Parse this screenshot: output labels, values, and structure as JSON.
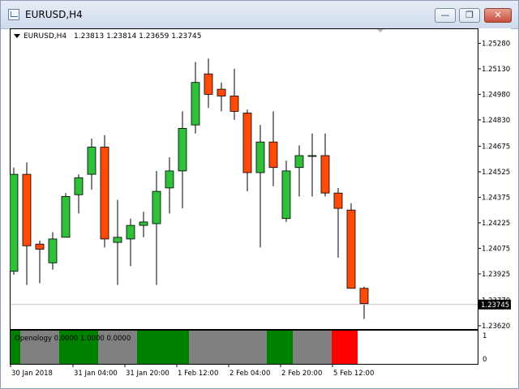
{
  "window": {
    "title": "EURUSD,H4",
    "app_icon": "chart-window-icon",
    "buttons": [
      "minimize-icon",
      "restore-icon",
      "close-icon"
    ],
    "button_glyphs": {
      "minimize": "—",
      "restore": "❐",
      "close": "✕"
    }
  },
  "chart_header": {
    "symbol": "EURUSD,H4",
    "ohlc": "1.23813 1.23814 1.23659 1.23745"
  },
  "indicator": {
    "label": "Openology 0.0000 1.0000 0.0000",
    "axis_labels": [
      "1",
      "0"
    ]
  },
  "colors": {
    "bull": "#2fbf3a",
    "bear": "#ff4b0a",
    "ind_green": "#008000",
    "ind_gray": "#808080",
    "ind_red": "#ff0000"
  },
  "chart_data": {
    "type": "candlestick",
    "ylim": [
      1.2362,
      1.2532
    ],
    "price_ticks": [
      "1.25280",
      "1.25130",
      "1.24980",
      "1.24830",
      "1.24675",
      "1.24525",
      "1.24375",
      "1.24225",
      "1.24075",
      "1.23925",
      "1.23770",
      "1.23620"
    ],
    "current_price": "1.23745",
    "x_labels": [
      "30 Jan 2018",
      "31 Jan 04:00",
      "31 Jan 20:00",
      "1 Feb 12:00",
      "2 Feb 04:00",
      "2 Feb 20:00",
      "5 Feb 12:00"
    ],
    "candles": [
      {
        "o": 1.2394,
        "h": 1.2455,
        "l": 1.2392,
        "c": 1.2451
      },
      {
        "o": 1.2451,
        "h": 1.2458,
        "l": 1.2386,
        "c": 1.2409
      },
      {
        "o": 1.241,
        "h": 1.2412,
        "l": 1.2387,
        "c": 1.2407
      },
      {
        "o": 1.2399,
        "h": 1.2417,
        "l": 1.2395,
        "c": 1.2413
      },
      {
        "o": 1.2414,
        "h": 1.244,
        "l": 1.2414,
        "c": 1.2438
      },
      {
        "o": 1.2439,
        "h": 1.2451,
        "l": 1.2428,
        "c": 1.2449
      },
      {
        "o": 1.2451,
        "h": 1.2472,
        "l": 1.2442,
        "c": 1.2467
      },
      {
        "o": 1.2467,
        "h": 1.2474,
        "l": 1.2408,
        "c": 1.2413
      },
      {
        "o": 1.2411,
        "h": 1.2436,
        "l": 1.2386,
        "c": 1.2414
      },
      {
        "o": 1.2413,
        "h": 1.2425,
        "l": 1.2397,
        "c": 1.2421
      },
      {
        "o": 1.2421,
        "h": 1.2429,
        "l": 1.2414,
        "c": 1.2423
      },
      {
        "o": 1.2422,
        "h": 1.2453,
        "l": 1.2386,
        "c": 1.2441
      },
      {
        "o": 1.2443,
        "h": 1.2461,
        "l": 1.2428,
        "c": 1.2453
      },
      {
        "o": 1.2453,
        "h": 1.2488,
        "l": 1.2431,
        "c": 1.2478
      },
      {
        "o": 1.248,
        "h": 1.2517,
        "l": 1.2475,
        "c": 1.2505
      },
      {
        "o": 1.251,
        "h": 1.2519,
        "l": 1.249,
        "c": 1.2498
      },
      {
        "o": 1.2501,
        "h": 1.2505,
        "l": 1.2488,
        "c": 1.2497
      },
      {
        "o": 1.2497,
        "h": 1.2513,
        "l": 1.2483,
        "c": 1.2488
      },
      {
        "o": 1.2487,
        "h": 1.2489,
        "l": 1.2441,
        "c": 1.2452
      },
      {
        "o": 1.2452,
        "h": 1.248,
        "l": 1.2408,
        "c": 1.247
      },
      {
        "o": 1.247,
        "h": 1.2488,
        "l": 1.2444,
        "c": 1.2455
      },
      {
        "o": 1.2425,
        "h": 1.2459,
        "l": 1.2423,
        "c": 1.2453
      },
      {
        "o": 1.2455,
        "h": 1.2468,
        "l": 1.2438,
        "c": 1.2462
      },
      {
        "o": 1.2462,
        "h": 1.2475,
        "l": 1.2438,
        "c": 1.2462
      },
      {
        "o": 1.2462,
        "h": 1.2475,
        "l": 1.2438,
        "c": 1.244
      },
      {
        "o": 1.244,
        "h": 1.2443,
        "l": 1.2402,
        "c": 1.2431
      },
      {
        "o": 1.243,
        "h": 1.2434,
        "l": 1.2386,
        "c": 1.2384
      },
      {
        "o": 1.2384,
        "h": 1.2385,
        "l": 1.2366,
        "c": 1.2375
      }
    ],
    "indicator_segments": [
      {
        "start": 0,
        "end": 1,
        "color": "green"
      },
      {
        "start": 1,
        "end": 4,
        "color": "gray"
      },
      {
        "start": 4,
        "end": 7,
        "color": "green"
      },
      {
        "start": 7,
        "end": 10,
        "color": "gray"
      },
      {
        "start": 10,
        "end": 14,
        "color": "green"
      },
      {
        "start": 14,
        "end": 20,
        "color": "gray"
      },
      {
        "start": 20,
        "end": 22,
        "color": "green"
      },
      {
        "start": 22,
        "end": 25,
        "color": "gray"
      },
      {
        "start": 25,
        "end": 27,
        "color": "red"
      }
    ]
  }
}
